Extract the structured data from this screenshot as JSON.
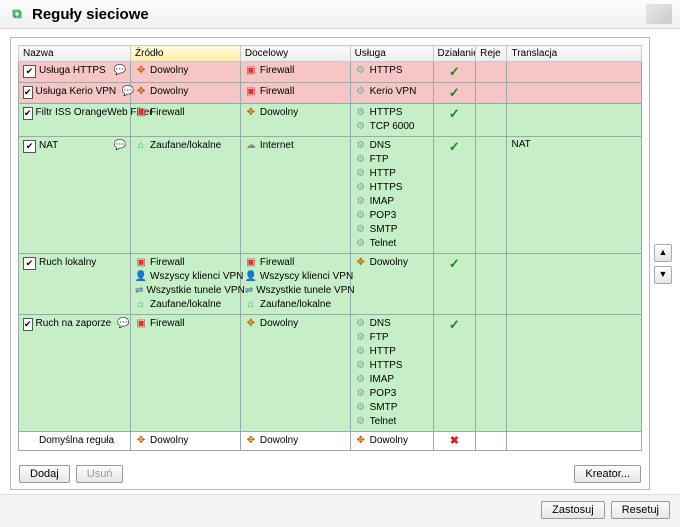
{
  "title": "Reguły sieciowe",
  "columns": [
    "Nazwa",
    "Źródło",
    "Docelowy",
    "Usługa",
    "Działanie",
    "Reje",
    "Translacja"
  ],
  "sortedColumn": 1,
  "icons": {
    "any": {
      "glyph": "✥",
      "color": "#c06000"
    },
    "firewall": {
      "glyph": "▣",
      "color": "#d33"
    },
    "net": {
      "glyph": "☁",
      "color": "#888"
    },
    "trusted": {
      "glyph": "⌂",
      "color": "#2a8"
    },
    "vpnclient": {
      "glyph": "👤",
      "color": "#369"
    },
    "vpntunnel": {
      "glyph": "⇌",
      "color": "#369"
    },
    "svc": {
      "glyph": "⚙",
      "color": "#7a9"
    },
    "chat": {
      "glyph": "💬",
      "color": "#e8a838"
    }
  },
  "rows": [
    {
      "tone": "pink",
      "checked": true,
      "chat": true,
      "name": "Usługa HTTPS",
      "source": [
        {
          "icon": "any",
          "text": "Dowolny"
        }
      ],
      "dest": [
        {
          "icon": "firewall",
          "text": "Firewall"
        }
      ],
      "service": [
        {
          "icon": "svc",
          "text": "HTTPS"
        }
      ],
      "action": "allow",
      "translation": ""
    },
    {
      "tone": "pink",
      "checked": true,
      "chat": true,
      "name": "Usługa Kerio VPN",
      "source": [
        {
          "icon": "any",
          "text": "Dowolny"
        }
      ],
      "dest": [
        {
          "icon": "firewall",
          "text": "Firewall"
        }
      ],
      "service": [
        {
          "icon": "svc",
          "text": "Kerio VPN"
        }
      ],
      "action": "allow",
      "translation": ""
    },
    {
      "tone": "green",
      "checked": true,
      "chat": false,
      "name": "Filtr ISS OrangeWeb Filter",
      "source": [
        {
          "icon": "firewall",
          "text": "Firewall"
        }
      ],
      "dest": [
        {
          "icon": "any",
          "text": "Dowolny"
        }
      ],
      "service": [
        {
          "icon": "svc",
          "text": "HTTPS"
        },
        {
          "icon": "svc",
          "text": "TCP 6000"
        }
      ],
      "action": "allow",
      "translation": ""
    },
    {
      "tone": "green",
      "checked": true,
      "chat": true,
      "name": "NAT",
      "source": [
        {
          "icon": "trusted",
          "text": "Zaufane/lokalne"
        }
      ],
      "dest": [
        {
          "icon": "net",
          "text": "Internet"
        }
      ],
      "service": [
        {
          "icon": "svc",
          "text": "DNS"
        },
        {
          "icon": "svc",
          "text": "FTP"
        },
        {
          "icon": "svc",
          "text": "HTTP"
        },
        {
          "icon": "svc",
          "text": "HTTPS"
        },
        {
          "icon": "svc",
          "text": "IMAP"
        },
        {
          "icon": "svc",
          "text": "POP3"
        },
        {
          "icon": "svc",
          "text": "SMTP"
        },
        {
          "icon": "svc",
          "text": "Telnet"
        }
      ],
      "action": "allow",
      "translation": "NAT"
    },
    {
      "tone": "green",
      "checked": true,
      "chat": false,
      "name": "Ruch lokalny",
      "source": [
        {
          "icon": "firewall",
          "text": "Firewall"
        },
        {
          "icon": "vpnclient",
          "text": "Wszyscy klienci VPN"
        },
        {
          "icon": "vpntunnel",
          "text": "Wszystkie tunele VPN"
        },
        {
          "icon": "trusted",
          "text": "Zaufane/lokalne"
        }
      ],
      "dest": [
        {
          "icon": "firewall",
          "text": "Firewall"
        },
        {
          "icon": "vpnclient",
          "text": "Wszyscy klienci VPN"
        },
        {
          "icon": "vpntunnel",
          "text": "Wszystkie tunele VPN"
        },
        {
          "icon": "trusted",
          "text": "Zaufane/lokalne"
        }
      ],
      "service": [
        {
          "icon": "any",
          "text": "Dowolny"
        }
      ],
      "action": "allow",
      "translation": ""
    },
    {
      "tone": "green",
      "checked": true,
      "chat": true,
      "name": "Ruch na zaporze",
      "source": [
        {
          "icon": "firewall",
          "text": "Firewall"
        }
      ],
      "dest": [
        {
          "icon": "any",
          "text": "Dowolny"
        }
      ],
      "service": [
        {
          "icon": "svc",
          "text": "DNS"
        },
        {
          "icon": "svc",
          "text": "FTP"
        },
        {
          "icon": "svc",
          "text": "HTTP"
        },
        {
          "icon": "svc",
          "text": "HTTPS"
        },
        {
          "icon": "svc",
          "text": "IMAP"
        },
        {
          "icon": "svc",
          "text": "POP3"
        },
        {
          "icon": "svc",
          "text": "SMTP"
        },
        {
          "icon": "svc",
          "text": "Telnet"
        }
      ],
      "action": "allow",
      "translation": ""
    },
    {
      "tone": "white",
      "checked": null,
      "chat": false,
      "name": "Domyślna reguła",
      "source": [
        {
          "icon": "any",
          "text": "Dowolny"
        }
      ],
      "dest": [
        {
          "icon": "any",
          "text": "Dowolny"
        }
      ],
      "service": [
        {
          "icon": "any",
          "text": "Dowolny"
        }
      ],
      "action": "deny",
      "translation": ""
    }
  ],
  "buttons": {
    "add": "Dodaj",
    "remove": "Usuń",
    "wizard": "Kreator...",
    "apply": "Zastosuj",
    "reset": "Resetuj"
  }
}
